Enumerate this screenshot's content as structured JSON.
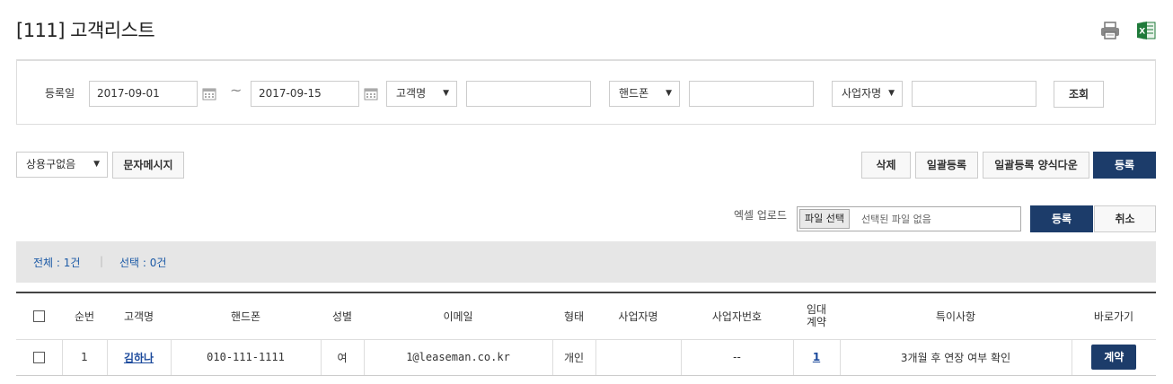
{
  "page": {
    "title": "[111] 고객리스트"
  },
  "toolbar_icons": [
    "print-icon",
    "excel-icon"
  ],
  "search": {
    "label": "등록일",
    "date_from": "2017-09-01",
    "date_to": "2017-09-15",
    "tilde": "~",
    "select_customer": "고객명",
    "select_phone": "핸드폰",
    "select_business": "사업자명",
    "search_button": "조회"
  },
  "actions": {
    "phrase_select": "상용구없음",
    "sms_button": "문자메시지",
    "delete_button": "삭제",
    "bulk_register_button": "일괄등록",
    "bulk_form_button": "일괄등록 양식다운",
    "register_button": "등록"
  },
  "upload": {
    "label": "엑셀 업로드",
    "file_button": "파일 선택",
    "file_text": "선택된 파일 없음",
    "register_button": "등록",
    "cancel_button": "취소"
  },
  "counts": {
    "total": "전체 : 1건",
    "separator": "|",
    "selected": "선택 : 0건"
  },
  "table": {
    "headers": [
      "순번",
      "고객명",
      "핸드폰",
      "성별",
      "이메일",
      "형태",
      "사업자명",
      "사업자번호",
      "임대 계약",
      "특이사항",
      "바로가기"
    ],
    "rows": [
      {
        "no": "1",
        "name": "김하나",
        "phone": "010-111-1111",
        "gender": "여",
        "email": "1@leaseman.co.kr",
        "type": "개인",
        "business_name": "",
        "business_no": "--",
        "lease_contract": "1",
        "note": "3개월 후 연장 여부 확인",
        "shortcut": "계약"
      }
    ]
  },
  "colors": {
    "primary": "#1c3c6a",
    "link": "#1c4a9c",
    "count_bg": "#e6e6e6"
  }
}
